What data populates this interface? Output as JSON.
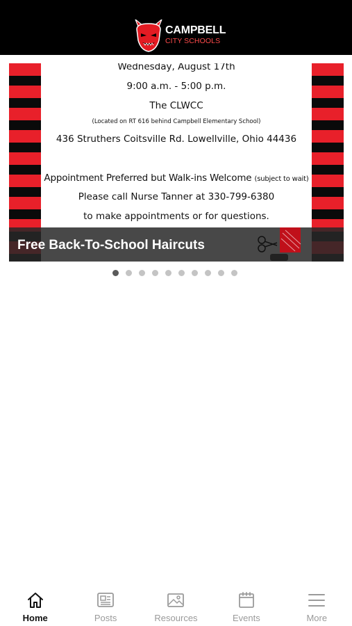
{
  "header": {
    "logo_title": "CAMPBELL",
    "logo_subtitle": "CITY SCHOOLS",
    "logo_icon": "red-devil-mascot-icon"
  },
  "carousel": {
    "caption": "Free Back-To-School Haircuts",
    "flyer_lines": {
      "date": "Wednesday, August 17th",
      "time": "9:00 a.m. - 5:00 p.m.",
      "place": "The CLWCC",
      "location_note": "(Located on RT 616 behind Campbell Elementary School)",
      "address": "436 Struthers Coitsville Rd. Lowellville, Ohio 44436",
      "appointment": "Appointment Preferred but Walk-ins Welcome",
      "appointment_note": "(subject to wait)",
      "call": "Please call Nurse Tanner at 330-799-6380",
      "questions": "to make appointments or for questions."
    },
    "stripe_colors": [
      "#e8202a",
      "#0a0a0a"
    ],
    "slide_count": 10,
    "active_slide": 1
  },
  "tabbar": {
    "tabs": [
      {
        "label": "Home",
        "icon": "home-icon",
        "active": true
      },
      {
        "label": "Posts",
        "icon": "newspaper-icon",
        "active": false
      },
      {
        "label": "Resources",
        "icon": "image-icon",
        "active": false
      },
      {
        "label": "Events",
        "icon": "calendar-icon",
        "active": false
      },
      {
        "label": "More",
        "icon": "menu-icon",
        "active": false
      }
    ]
  }
}
